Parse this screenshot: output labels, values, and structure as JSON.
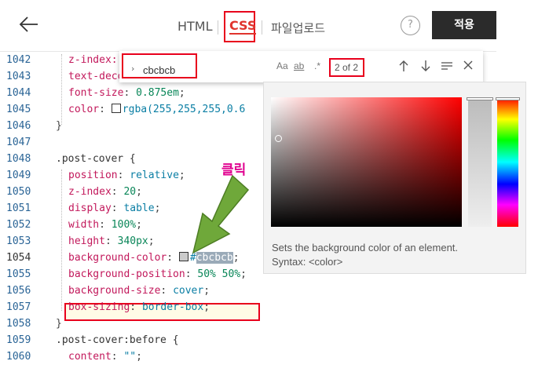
{
  "toolbar": {
    "back_icon": "arrow-left-icon",
    "tabs": [
      {
        "label": "HTML"
      },
      {
        "label": "CSS"
      },
      {
        "label": "파일업로드"
      }
    ],
    "help_label": "?",
    "apply_label": "적용",
    "active_color": "#e0342d"
  },
  "find": {
    "query": "cbcbcb",
    "match_case": "Aa",
    "whole_word": "ab",
    "regex": ".*",
    "count": "2 of 2",
    "prev_icon": "arrow-up-icon",
    "next_icon": "arrow-down-icon",
    "selection_icon": "lines-icon",
    "close_icon": "close-icon"
  },
  "picker": {
    "description": "Sets the background color of an element.",
    "syntax": "Syntax: <color>"
  },
  "annotation": {
    "click_label": "클릭"
  },
  "lines": [
    {
      "n": "1042",
      "text": "  z-index:"
    },
    {
      "n": "1043",
      "text": "  text-decoration: underline;"
    },
    {
      "n": "1044",
      "text": "  font-size: 0.875em;"
    },
    {
      "n": "1045",
      "text": "  color: rgba(255,255,255,0.6"
    },
    {
      "n": "1046",
      "text": "}"
    },
    {
      "n": "1047",
      "text": ""
    },
    {
      "n": "1048",
      "text": ".post-cover {"
    },
    {
      "n": "1049",
      "text": "  position: relative;"
    },
    {
      "n": "1050",
      "text": "  z-index: 20;"
    },
    {
      "n": "1051",
      "text": "  display: table;"
    },
    {
      "n": "1052",
      "text": "  width: 100%;"
    },
    {
      "n": "1053",
      "text": "  height: 340px;"
    },
    {
      "n": "1054",
      "text": "  background-color: #cbcbcb;"
    },
    {
      "n": "1055",
      "text": "  background-position: 50% 50%;"
    },
    {
      "n": "1056",
      "text": "  background-size: cover;"
    },
    {
      "n": "1057",
      "text": "  box-sizing: border-box;"
    },
    {
      "n": "1058",
      "text": "}"
    },
    {
      "n": "1059",
      "text": ".post-cover:before {"
    },
    {
      "n": "1060",
      "text": "  content: \"\";"
    }
  ],
  "swatch_color_1045": "#ffffff",
  "swatch_color_1054": "#cbcbcb"
}
